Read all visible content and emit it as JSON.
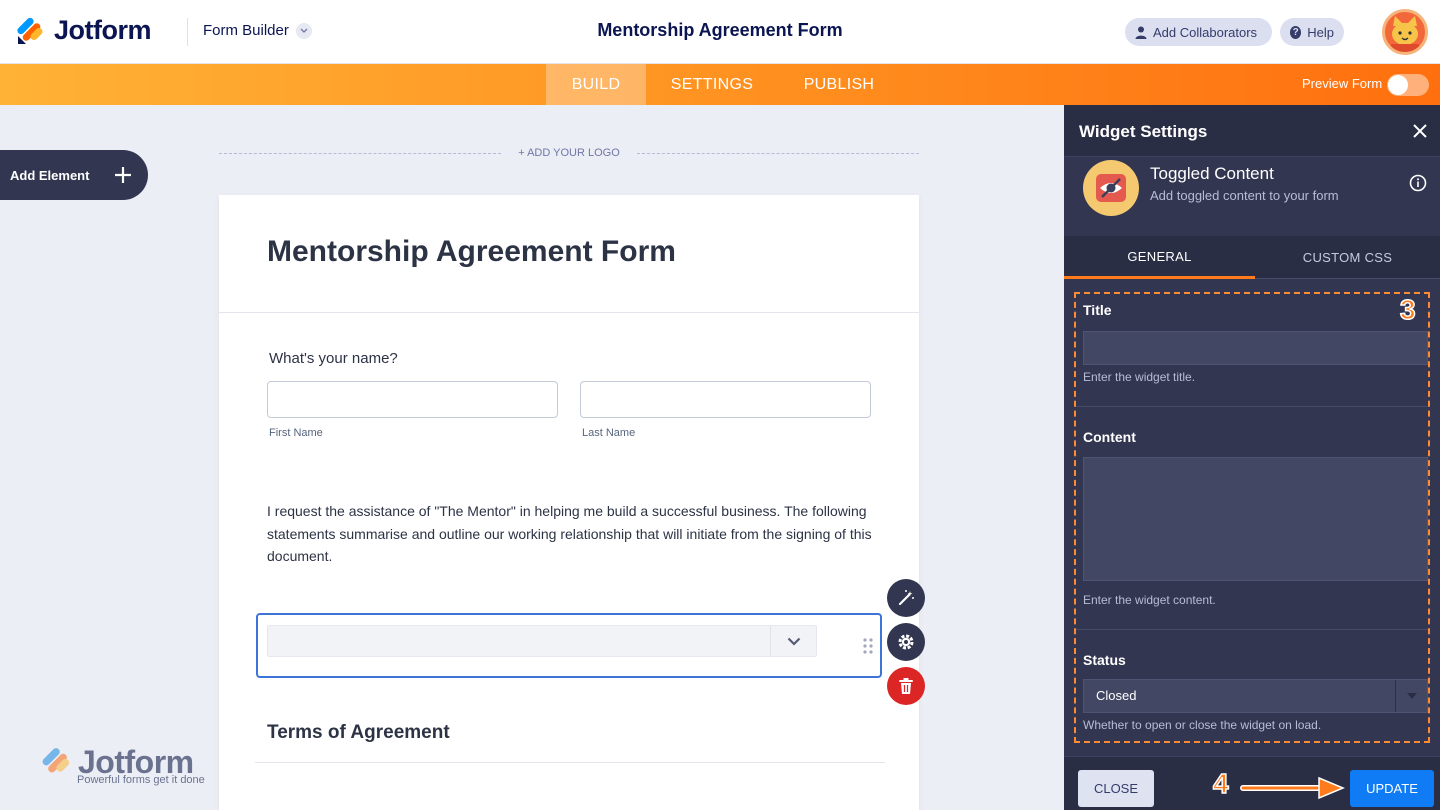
{
  "header": {
    "brand": "Jotform",
    "builder_label": "Form Builder",
    "doc_title": "Mentorship Agreement Form",
    "add_collaborators": "Add Collaborators",
    "help": "Help"
  },
  "nav": {
    "tabs": [
      {
        "label": "BUILD",
        "active": true
      },
      {
        "label": "SETTINGS",
        "active": false
      },
      {
        "label": "PUBLISH",
        "active": false
      }
    ],
    "preview_label": "Preview Form",
    "preview_on": false
  },
  "builder": {
    "add_element": "Add Element",
    "add_logo": "+ ADD YOUR LOGO"
  },
  "form": {
    "title": "Mentorship Agreement Form",
    "name_question": "What's your name?",
    "first_name_label": "First Name",
    "last_name_label": "Last Name",
    "paragraph": "I request the assistance of \"The Mentor\" in helping me build a successful business. The following statements summarise and outline our working relationship that will initiate from the signing of this document.",
    "section_heading": "Terms of Agreement"
  },
  "watermark": {
    "brand": "Jotform",
    "tagline": "Powerful forms get it done"
  },
  "panel": {
    "title": "Widget Settings",
    "widget_name": "Toggled Content",
    "widget_desc": "Add toggled content to your form",
    "tabs": [
      {
        "label": "GENERAL",
        "active": true
      },
      {
        "label": "CUSTOM CSS",
        "active": false
      }
    ],
    "fields": {
      "title_label": "Title",
      "title_value": "",
      "title_help": "Enter the widget title.",
      "content_label": "Content",
      "content_value": "",
      "content_help": "Enter the widget content.",
      "status_label": "Status",
      "status_value": "Closed",
      "status_help": "Whether to open or close the widget on load."
    },
    "annotation_step_fields": "3",
    "annotation_step_update": "4",
    "close_button": "CLOSE",
    "update_button": "UPDATE"
  },
  "colors": {
    "accent_orange": "#ff7b1c",
    "nav_dark": "#323650",
    "primary_blue": "#0f7cf5",
    "delete_red": "#dc2626"
  }
}
